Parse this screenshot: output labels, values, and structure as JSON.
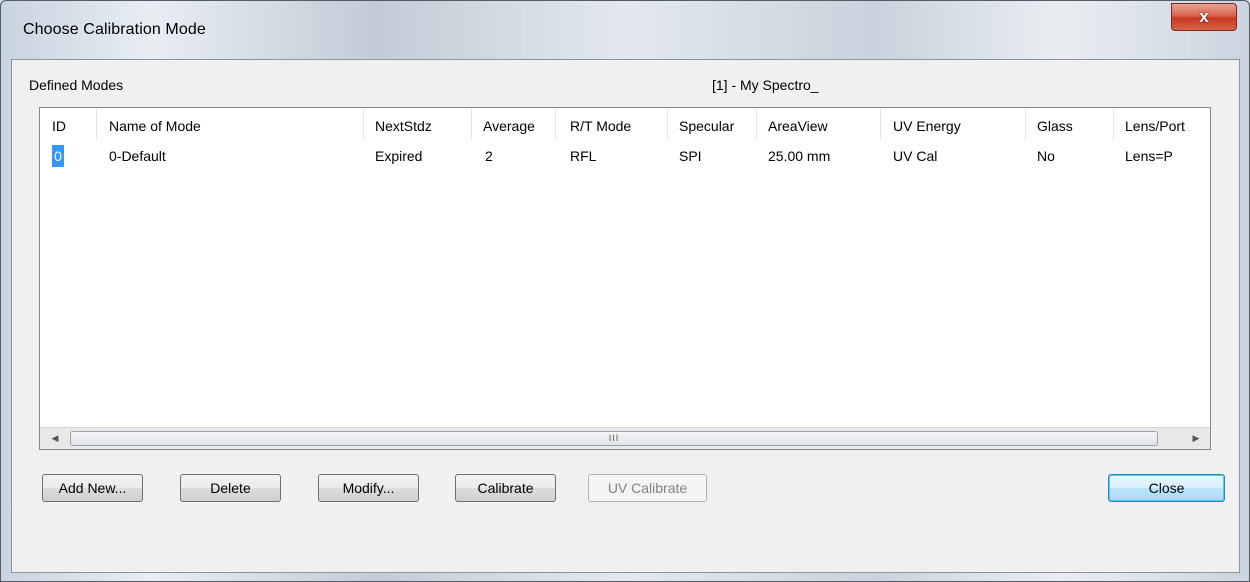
{
  "window": {
    "title": "Choose Calibration Mode",
    "close_glyph": "x"
  },
  "section_label": "Defined Modes",
  "device_label": "[1] - My Spectro_",
  "table": {
    "columns": [
      "ID",
      "Name of Mode",
      "NextStdz",
      "Average",
      "R/T Mode",
      "Specular",
      "AreaView",
      "UV Energy",
      "Glass",
      "Lens/Port"
    ],
    "rows": [
      [
        "0",
        "0-Default",
        "Expired",
        "2",
        "RFL",
        "SPI",
        "25.00 mm",
        "UV Cal",
        "No",
        "Lens=P"
      ]
    ]
  },
  "scrollbar": {
    "left_arrow": "◀",
    "right_arrow": "▶",
    "grip": "III"
  },
  "buttons": {
    "add_new": "Add New...",
    "delete": "Delete",
    "modify": "Modify...",
    "calibrate": "Calibrate",
    "uv_calibrate": "UV Calibrate",
    "close": "Close"
  },
  "icons": {
    "left_arrow": "left-arrow-icon",
    "right_arrow": "right-arrow-icon",
    "close": "close-icon"
  }
}
